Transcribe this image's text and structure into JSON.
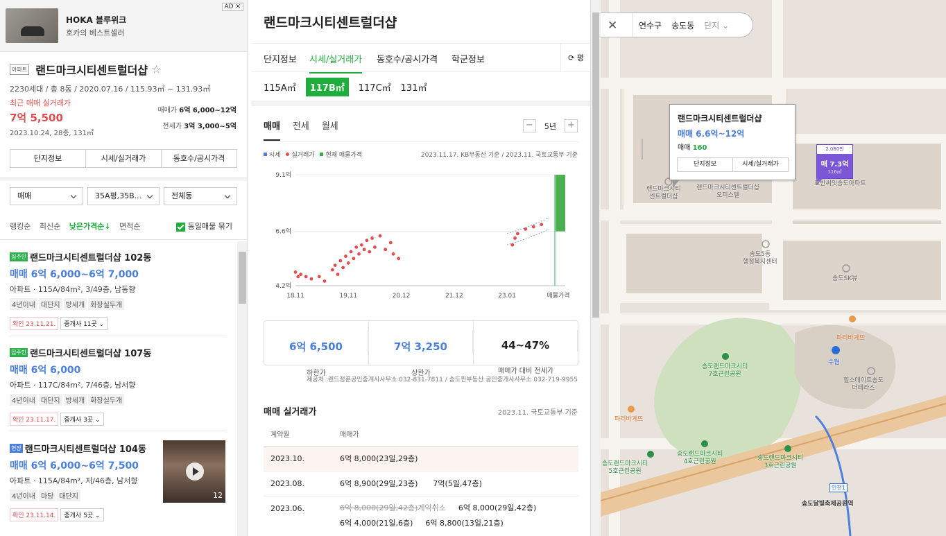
{
  "ad": {
    "title": "HOKA 블루위크",
    "subtitle": "호카의 베스트셀러",
    "tag": "AD ✕"
  },
  "complex": {
    "tag": "아파트",
    "name": "랜드마크시티센트럴더샵",
    "star": "☆",
    "info": "2230세대 / 총 8동 / 2020.07.16 / 115.93㎡ ~ 131.93㎡",
    "recent_label": "최근 매매 실거래가",
    "recent_price": "7억 5,500",
    "recent_date": "2023.10.24, 28층, 131㎡",
    "sale_label": "매매가",
    "sale_range": "6억 6,000~12억",
    "jeonse_label": "전세가",
    "jeonse_range": "3억 3,000~5억",
    "buttons": [
      "단지정보",
      "시세/실거래가",
      "동호수/공시가격"
    ]
  },
  "filters": {
    "deal": "매매",
    "area": "35A평,35B...",
    "dong": "전체동",
    "sorts": [
      "랭킹순",
      "최신순",
      "낮은가격순↓",
      "면적순"
    ],
    "active_sort": "낮은가격순↓",
    "group_label": "동일매물 묶기"
  },
  "listings": [
    {
      "badge": "집주인",
      "badge_color": "#2eaf4e",
      "name": "랜드마크시티센트럴더샵 102동",
      "price": "매매 6억 6,000~6억 7,000",
      "desc": "아파트 · 115A/84m², 3/49층, 남동향",
      "tags": [
        "4년이내",
        "대단지",
        "방세개",
        "화장실두개"
      ],
      "confirm": "확인 23.11.21.",
      "brokers": "중개사 11곳"
    },
    {
      "badge": "집주인",
      "badge_color": "#2eaf4e",
      "name": "랜드마크시티센트럴더샵 107동",
      "price": "매매 6억 6,000",
      "desc": "아파트 · 117C/84m², 7/46층, 남서향",
      "tags": [
        "4년이내",
        "대단지",
        "방세개",
        "화장실두개"
      ],
      "confirm": "확인 23.11.17.",
      "brokers": "중개사 3곳"
    },
    {
      "badge": "현장",
      "badge_color": "#4a7fdc",
      "name": "랜드마크시티센트럴더샵 104동",
      "price": "매매 6억 6,000~6억 7,500",
      "desc": "아파트 · 115A/84m², 저/46층, 남서향",
      "tags": [
        "4년이내",
        "마당",
        "대단지"
      ],
      "confirm": "확인 23.11.14.",
      "brokers": "중개사 5곳",
      "photo_count": "12"
    }
  ],
  "detail": {
    "title": "랜드마크시티센트럴더샵",
    "tabs": [
      "단지정보",
      "시세/실거래가",
      "동호수/공시가격",
      "학군정보"
    ],
    "active_tab": "시세/실거래가",
    "refresh": "⟳ 평",
    "types": [
      "115A㎡",
      "117B㎡",
      "117C㎡",
      "131㎡"
    ],
    "active_type": "117B㎡",
    "subtabs": [
      "매매",
      "전세",
      "월세"
    ],
    "period": "5년",
    "minus": "−",
    "plus": "+",
    "legend": [
      {
        "label": "시세",
        "color": "#4a7fdc"
      },
      {
        "label": "실거래가",
        "color": "#e04e4e"
      },
      {
        "label": "현재 매물가격",
        "color": "#2eaf4e"
      }
    ],
    "basis": "2023.11.17. KB부동산 기준 / 2023.11. 국토교통부 기준",
    "stats": [
      {
        "value": "6억 6,500",
        "label": "하한가"
      },
      {
        "value": "7억 3,250",
        "label": "상한가"
      },
      {
        "value": "44~47%",
        "label": "매매가 대비 전세가"
      }
    ],
    "source": "제공처 :랜드정푼공인중개사사무소 032-831-7811 / 송도핀부동산 공인중개사사무소 032-719-9955",
    "recent_title": "매매 실거래가",
    "recent_basis": "2023.11. 국토교통부 기준",
    "table_headers": [
      "계약월",
      "매매가"
    ],
    "rows": [
      {
        "month": "2023.10.",
        "entries": [
          "6억 8,000(23일,29층)"
        ]
      },
      {
        "month": "2023.08.",
        "entries": [
          "6억 8,900(29일,23층)",
          "7억(5일,47층)"
        ]
      },
      {
        "month": "2023.06.",
        "cancelled": "6억 8,000(29일,42층)",
        "cancel_label": "계약취소",
        "entries": [
          "6억 8,000(29일,42층)"
        ],
        "entries2": [
          "6억 4,000(21일,6층)",
          "6억 8,800(13일,21층)"
        ]
      }
    ]
  },
  "chart_data": {
    "type": "scatter",
    "ylim": [
      4.2,
      9.1
    ],
    "yticks": [
      "9.1억",
      "6.6억",
      "4.2억"
    ],
    "yvals": [
      9.1,
      6.6,
      4.2
    ],
    "xticks": [
      "18.11",
      "19.11",
      "20.12",
      "21.12",
      "23.01",
      "매물가격"
    ],
    "series": [
      {
        "name": "실거래가",
        "values": [
          [
            0,
            4.8
          ],
          [
            0.05,
            4.6
          ],
          [
            0.1,
            4.7
          ],
          [
            0.2,
            4.6
          ],
          [
            0.3,
            4.5
          ],
          [
            0.45,
            4.6
          ],
          [
            0.55,
            4.4
          ],
          [
            0.7,
            4.9
          ],
          [
            0.75,
            5.1
          ],
          [
            0.8,
            4.7
          ],
          [
            0.85,
            5.3
          ],
          [
            0.9,
            5.0
          ],
          [
            0.95,
            5.5
          ],
          [
            1.0,
            5.2
          ],
          [
            1.05,
            5.7
          ],
          [
            1.1,
            5.4
          ],
          [
            1.15,
            5.9
          ],
          [
            1.2,
            5.6
          ],
          [
            1.25,
            6.0
          ],
          [
            1.3,
            5.8
          ],
          [
            1.35,
            6.2
          ],
          [
            1.4,
            5.7
          ],
          [
            1.45,
            6.3
          ],
          [
            1.5,
            5.9
          ],
          [
            1.6,
            6.4
          ],
          [
            1.7,
            5.8
          ],
          [
            1.8,
            6.1
          ],
          [
            1.85,
            5.6
          ],
          [
            1.95,
            5.4
          ],
          [
            4.1,
            6.0
          ],
          [
            4.15,
            6.3
          ],
          [
            4.2,
            6.5
          ],
          [
            4.35,
            6.7
          ],
          [
            4.5,
            6.8
          ],
          [
            4.65,
            6.9
          ]
        ]
      },
      {
        "name": "시세",
        "values": [
          [
            4.0,
            6.3
          ],
          [
            4.4,
            6.6
          ],
          [
            4.8,
            7.0
          ]
        ]
      },
      {
        "name": "현재 매물가격",
        "values": [
          [
            5.1,
            6.6
          ],
          [
            5.1,
            9.1
          ]
        ]
      }
    ]
  },
  "map": {
    "close": "✕",
    "region1": "연수구",
    "region2": "송도동",
    "region3": "단지",
    "popup_title": "랜드마크시티센트럴더샵",
    "popup_price": "매매 6.6억~12억",
    "popup_count_label": "매매",
    "popup_count": "160",
    "popup_btn1": "단지정보",
    "popup_btn2": "시세/실거래가",
    "marker_top": "2,080만",
    "marker_price": "매 7.3억",
    "marker_area": "116㎡",
    "labels": [
      "랜드마크시티\n센트럴더샵",
      "랜드마크시티센트럴더샵\n오피스텔",
      "호반써밋송도아파트",
      "송도5동\n행정복지센터",
      "송도SK뷰",
      "파리바게뜨",
      "수협",
      "송도랜드마크시티\n7호근린공원",
      "힐스테이트송도\n더테라스",
      "파리바게뜨",
      "송도랜드마크시티\n4호근린공원",
      "송도랜드마크시티\n3호근린공원",
      "송도랜드마크시티\n5호근린공원",
      "송도달빛축제공원역",
      "인천1"
    ]
  }
}
